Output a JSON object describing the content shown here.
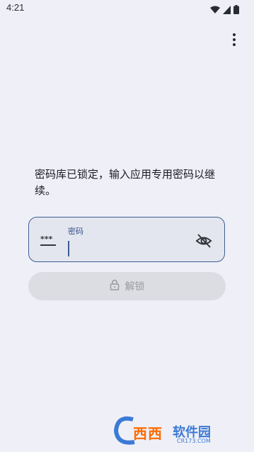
{
  "status_bar": {
    "time": "4:21",
    "icons": [
      "wifi-icon",
      "signal-icon",
      "battery-icon"
    ]
  },
  "toolbar": {
    "overflow_icon": "more-vertical-icon"
  },
  "lock_screen": {
    "message": "密码库已锁定，输入应用专用密码以继续。",
    "password_field": {
      "label": "密码",
      "value": "",
      "leading_icon": "password-icon",
      "trailing_icon": "visibility-off-icon"
    },
    "unlock_button": {
      "label": "解锁",
      "icon": "lock-icon",
      "enabled": false
    }
  },
  "watermark": {
    "brand": "西西",
    "text": "软件园",
    "sub": "CR173.COM"
  },
  "colors": {
    "background": "#eff0f7",
    "accent": "#3f5d92",
    "button_disabled": "#dcdde3"
  }
}
